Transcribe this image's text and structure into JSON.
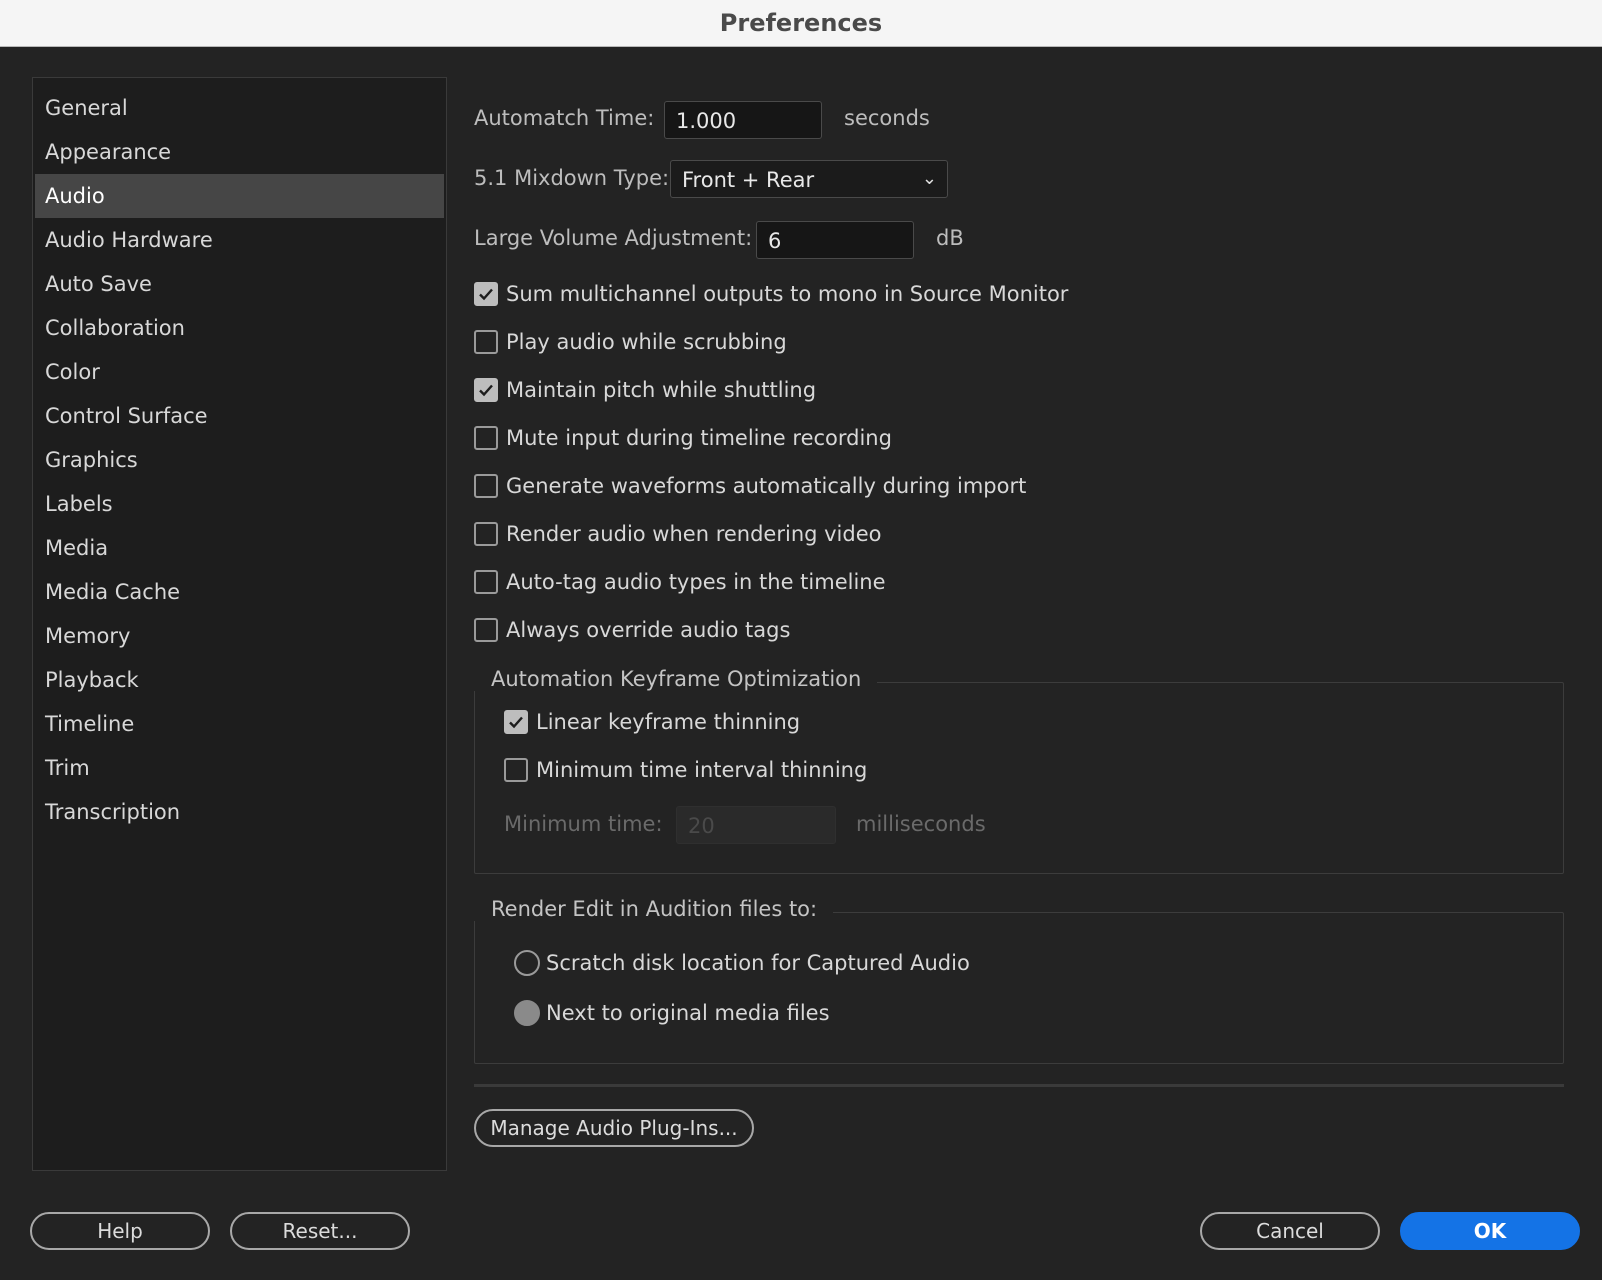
{
  "window": {
    "title": "Preferences"
  },
  "sidebar": {
    "items": [
      {
        "label": "General",
        "selected": false
      },
      {
        "label": "Appearance",
        "selected": false
      },
      {
        "label": "Audio",
        "selected": true
      },
      {
        "label": "Audio Hardware",
        "selected": false
      },
      {
        "label": "Auto Save",
        "selected": false
      },
      {
        "label": "Collaboration",
        "selected": false
      },
      {
        "label": "Color",
        "selected": false
      },
      {
        "label": "Control Surface",
        "selected": false
      },
      {
        "label": "Graphics",
        "selected": false
      },
      {
        "label": "Labels",
        "selected": false
      },
      {
        "label": "Media",
        "selected": false
      },
      {
        "label": "Media Cache",
        "selected": false
      },
      {
        "label": "Memory",
        "selected": false
      },
      {
        "label": "Playback",
        "selected": false
      },
      {
        "label": "Timeline",
        "selected": false
      },
      {
        "label": "Trim",
        "selected": false
      },
      {
        "label": "Transcription",
        "selected": false
      }
    ]
  },
  "audio": {
    "automatch": {
      "label": "Automatch Time:",
      "value": "1.000",
      "unit": "seconds"
    },
    "mixdown": {
      "label": "5.1 Mixdown Type:",
      "value": "Front + Rear"
    },
    "large_volume": {
      "label": "Large Volume Adjustment:",
      "value": "6",
      "unit": "dB"
    },
    "checkboxes": [
      {
        "label": "Sum multichannel outputs to mono in Source Monitor",
        "checked": true
      },
      {
        "label": "Play audio while scrubbing",
        "checked": false
      },
      {
        "label": "Maintain pitch while shuttling",
        "checked": true
      },
      {
        "label": "Mute input during timeline recording",
        "checked": false
      },
      {
        "label": "Generate waveforms automatically during import",
        "checked": false
      },
      {
        "label": "Render audio when rendering video",
        "checked": false
      },
      {
        "label": "Auto-tag audio types in the timeline",
        "checked": false
      },
      {
        "label": "Always override audio tags",
        "checked": false
      }
    ],
    "keyframe_group": {
      "title": "Automation Keyframe Optimization",
      "checkboxes": [
        {
          "label": "Linear keyframe thinning",
          "checked": true
        },
        {
          "label": "Minimum time interval thinning",
          "checked": false
        }
      ],
      "min_time": {
        "label": "Minimum time:",
        "value": "20",
        "unit": "milliseconds"
      }
    },
    "render_group": {
      "title": "Render Edit in Audition files to:",
      "options": [
        {
          "label": "Scratch disk location for Captured Audio",
          "selected": false
        },
        {
          "label": "Next to original media files",
          "selected": true
        }
      ]
    },
    "manage_plugins_label": "Manage Audio Plug-Ins..."
  },
  "footer": {
    "help_label": "Help",
    "reset_label": "Reset...",
    "cancel_label": "Cancel",
    "ok_label": "OK"
  }
}
